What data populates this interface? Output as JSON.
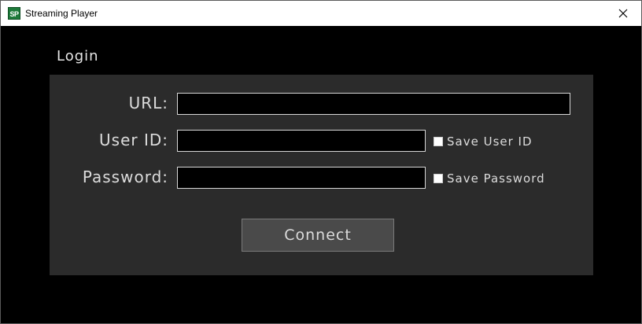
{
  "window": {
    "title": "Streaming Player",
    "icon_text": "SP",
    "close_icon": "close-icon"
  },
  "login": {
    "heading": "Login",
    "url_label": "URL:",
    "url_value": "",
    "userid_label": "User ID:",
    "userid_value": "",
    "save_userid_label": "Save User ID",
    "save_userid_checked": false,
    "password_label": "Password:",
    "password_value": "",
    "save_password_label": "Save Password",
    "save_password_checked": false,
    "connect_label": "Connect"
  },
  "colors": {
    "background": "#000000",
    "panel": "#2b2b2b",
    "button": "#4a4a4a",
    "text": "#dcdcdc",
    "icon": "#1e7a3a"
  }
}
